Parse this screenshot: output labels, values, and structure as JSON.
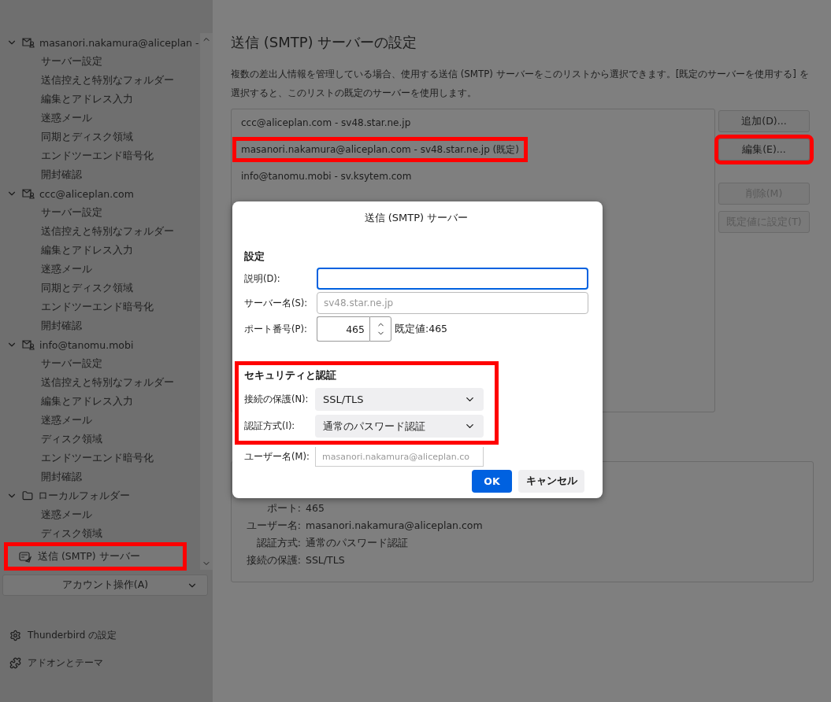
{
  "sidebar": {
    "accounts": [
      {
        "kind": "mail",
        "label": "masanori.nakamura@aliceplan -",
        "expanded": true,
        "children": [
          {
            "label": "サーバー設定"
          },
          {
            "label": "送信控えと特別なフォルダー"
          },
          {
            "label": "編集とアドレス入力"
          },
          {
            "label": "迷惑メール"
          },
          {
            "label": "同期とディスク領域"
          },
          {
            "label": "エンドツーエンド暗号化"
          },
          {
            "label": "開封確認"
          }
        ]
      },
      {
        "kind": "mail",
        "label": "ccc@aliceplan.com",
        "expanded": true,
        "children": [
          {
            "label": "サーバー設定"
          },
          {
            "label": "送信控えと特別なフォルダー"
          },
          {
            "label": "編集とアドレス入力"
          },
          {
            "label": "迷惑メール"
          },
          {
            "label": "同期とディスク領域"
          },
          {
            "label": "エンドツーエンド暗号化"
          },
          {
            "label": "開封確認"
          }
        ]
      },
      {
        "kind": "mail",
        "label": "info@tanomu.mobi",
        "expanded": true,
        "children": [
          {
            "label": "サーバー設定"
          },
          {
            "label": "送信控えと特別なフォルダー"
          },
          {
            "label": "編集とアドレス入力"
          },
          {
            "label": "迷惑メール"
          },
          {
            "label": "ディスク領域"
          },
          {
            "label": "エンドツーエンド暗号化"
          },
          {
            "label": "開封確認"
          }
        ]
      },
      {
        "kind": "folder",
        "label": "ローカルフォルダー",
        "expanded": true,
        "children": [
          {
            "label": "迷惑メール"
          },
          {
            "label": "ディスク領域"
          }
        ]
      }
    ],
    "smtp_item": {
      "label": "送信 (SMTP) サーバー",
      "highlighted": true
    },
    "account_actions": "アカウント操作(A)",
    "footer": [
      {
        "kind": "settings",
        "label": "Thunderbird の設定"
      },
      {
        "kind": "addons",
        "label": "アドオンとテーマ"
      }
    ]
  },
  "main": {
    "title": "送信 (SMTP) サーバーの設定",
    "description": "複数の差出人情報を管理している場合、使用する送信 (SMTP) サーバーをこのリストから選択できます。[既定のサーバーを使用する] を選択すると、このリストの既定のサーバーを使用します。",
    "servers": [
      {
        "label": "ccc@aliceplan.com - sv48.star.ne.jp",
        "highlighted": false
      },
      {
        "label": "masanori.nakamura@aliceplan.com - sv48.star.ne.jp (既定)",
        "highlighted": true
      },
      {
        "label": "info@tanomu.mobi - sv.ksytem.com",
        "highlighted": false
      }
    ],
    "buttons": [
      {
        "label": "追加(D)...",
        "disabled": false,
        "highlighted": false
      },
      {
        "label": "編集(E)...",
        "disabled": false,
        "highlighted": true
      },
      {
        "label": "削除(M)",
        "disabled": true,
        "highlighted": false
      },
      {
        "label": "既定値に設定(T)",
        "disabled": true,
        "highlighted": false
      }
    ],
    "details": [
      {
        "label": "ポート:",
        "value": "465"
      },
      {
        "label": "ユーザー名:",
        "value": "masanori.nakamura@aliceplan.com"
      },
      {
        "label": "認証方式:",
        "value": "通常のパスワード認証"
      },
      {
        "label": "接続の保護:",
        "value": "SSL/TLS"
      }
    ]
  },
  "dialog": {
    "title": "送信 (SMTP) サーバー",
    "settings_heading": "設定",
    "description_label": "説明(D):",
    "server_label": "サーバー名(S):",
    "server_value": "sv48.star.ne.jp",
    "port_label": "ポート番号(P):",
    "port_value": "465",
    "port_default": "既定値:465",
    "security": {
      "heading": "セキュリティと認証",
      "highlighted": true,
      "connection_label": "接続の保護(N):",
      "connection_value": "SSL/TLS",
      "auth_label": "認証方式(I):",
      "auth_value": "通常のパスワード認証"
    },
    "username_label": "ユーザー名(M):",
    "username_value": "masanori.nakamura@aliceplan.co",
    "ok": "OK",
    "cancel": "キャンセル"
  }
}
